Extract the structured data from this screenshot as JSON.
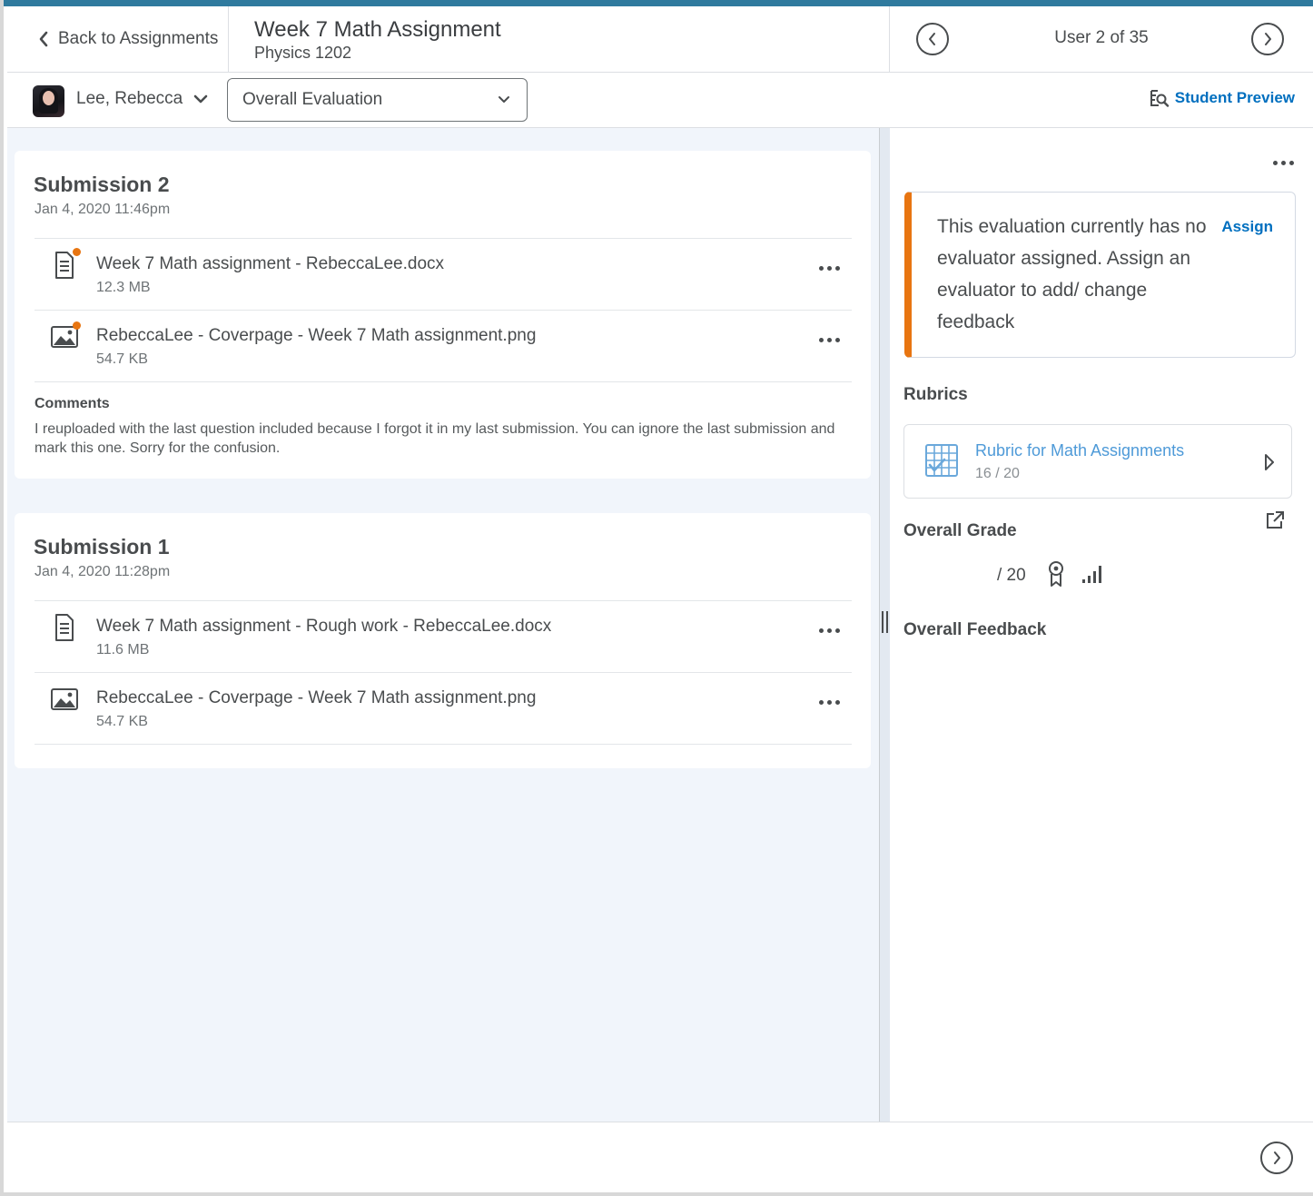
{
  "header": {
    "back_label": "Back to Assignments",
    "assignment_title": "Week 7 Math Assignment",
    "course_name": "Physics 1202",
    "user_position": "User 2 of 35"
  },
  "subheader": {
    "student_name": "Lee, Rebecca",
    "evaluation_view": "Overall Evaluation",
    "student_preview_label": "Student Preview"
  },
  "submissions": [
    {
      "title": "Submission 2",
      "date": "Jan 4, 2020 11:46pm",
      "files": [
        {
          "name": "Week 7 Math assignment - RebeccaLee.docx",
          "size": "12.3 MB",
          "type": "document-icon",
          "unread": true
        },
        {
          "name": "RebeccaLee - Coverpage - Week 7 Math assignment.png",
          "size": "54.7 KB",
          "type": "image-icon",
          "unread": true
        }
      ],
      "comments_label": "Comments",
      "comments": "I reuploaded with the last question included because I forgot it in my last submission. You can ignore the last submission and mark this one. Sorry for the confusion."
    },
    {
      "title": "Submission 1",
      "date": "Jan 4, 2020 11:28pm",
      "files": [
        {
          "name": "Week 7 Math assignment - Rough work - RebeccaLee.docx",
          "size": "11.6 MB",
          "type": "document-icon",
          "unread": false
        },
        {
          "name": "RebeccaLee - Coverpage - Week 7 Math assignment.png",
          "size": "54.7 KB",
          "type": "image-icon",
          "unread": false
        }
      ]
    }
  ],
  "evaluation": {
    "alert_message": "This evaluation currently has no evaluator assigned. Assign an evaluator to add/ change feedback",
    "assign_label": "Assign",
    "rubrics_heading": "Rubrics",
    "rubric": {
      "name": "Rubric for Math Assignments",
      "score": "16  / 20"
    },
    "overall_grade_heading": "Overall Grade",
    "grade_value": "",
    "grade_out_of": "/ 20",
    "overall_feedback_heading": "Overall Feedback"
  },
  "colors": {
    "accent": "#006fbf",
    "alert_stripe": "#e87511",
    "unread_dot": "#e87511",
    "rubric_link": "#4e9ad8",
    "top_bar": "#2f7a9e"
  }
}
